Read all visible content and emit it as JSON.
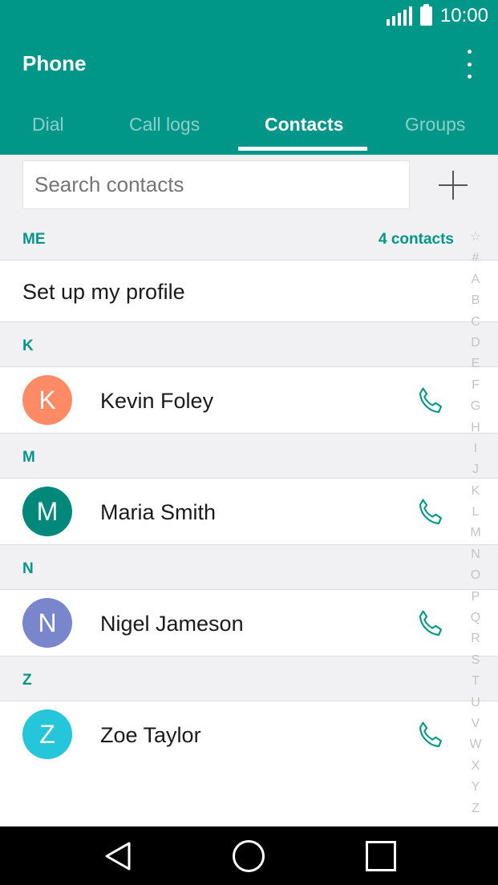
{
  "status_bar": {
    "time": "10:00"
  },
  "app": {
    "title": "Phone"
  },
  "tabs": [
    {
      "label": "Dial",
      "active": false
    },
    {
      "label": "Call logs",
      "active": false
    },
    {
      "label": "Contacts",
      "active": true
    },
    {
      "label": "Groups",
      "active": false
    }
  ],
  "search": {
    "placeholder": "Search contacts",
    "value": ""
  },
  "me_section": {
    "letter": "ME",
    "count_label": "4 contacts",
    "profile_label": "Set up my profile"
  },
  "sections": [
    {
      "letter": "K",
      "contact": {
        "initial": "K",
        "name": "Kevin Foley",
        "avatar_color": "#ff8a65"
      }
    },
    {
      "letter": "M",
      "contact": {
        "initial": "M",
        "name": "Maria Smith",
        "avatar_color": "#00897b"
      }
    },
    {
      "letter": "N",
      "contact": {
        "initial": "N",
        "name": "Nigel Jameson",
        "avatar_color": "#7986cb"
      }
    },
    {
      "letter": "Z",
      "contact": {
        "initial": "Z",
        "name": "Zoe Taylor",
        "avatar_color": "#26c6da"
      }
    }
  ],
  "index_bar": [
    "☆",
    "#",
    "A",
    "B",
    "C",
    "D",
    "E",
    "F",
    "G",
    "H",
    "I",
    "J",
    "K",
    "L",
    "M",
    "N",
    "O",
    "P",
    "Q",
    "R",
    "S",
    "T",
    "U",
    "V",
    "W",
    "X",
    "Y",
    "Z"
  ],
  "colors": {
    "accent": "#009688",
    "call_icon": "#009688"
  },
  "icons": {
    "add": "plus-icon",
    "call": "phone-icon",
    "menu": "overflow-menu-icon"
  }
}
